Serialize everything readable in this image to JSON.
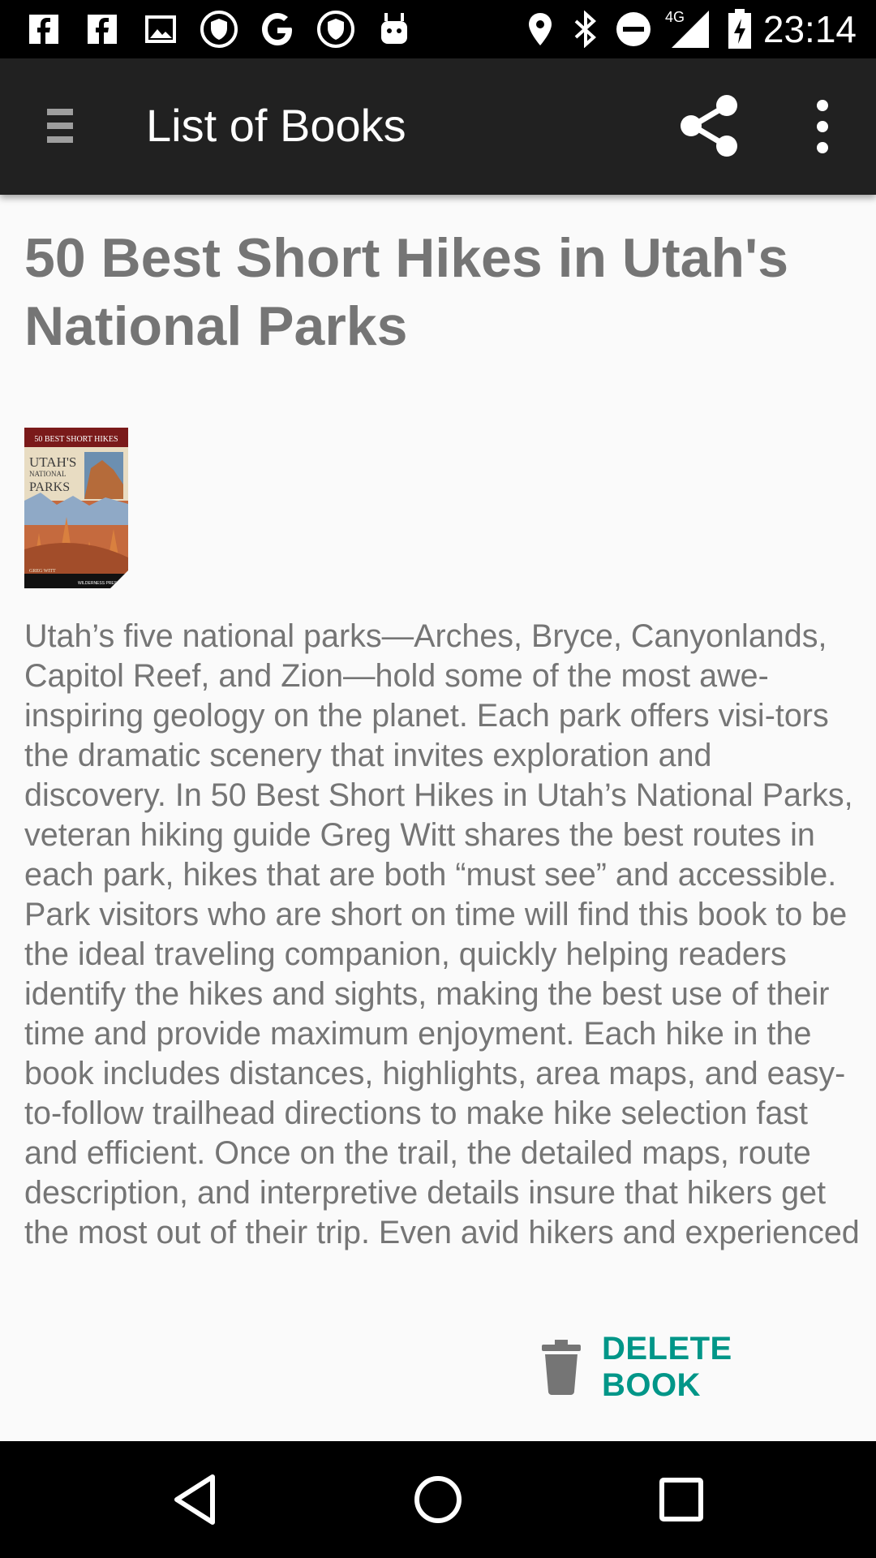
{
  "status_bar": {
    "time": "23:14",
    "network": "4G",
    "icons": [
      "facebook-icon",
      "facebook-icon",
      "image-icon",
      "shield-icon",
      "google-icon",
      "shield-icon",
      "android-icon",
      "location-icon",
      "bluetooth-icon",
      "dnd-icon",
      "signal-icon",
      "battery-charging-icon"
    ]
  },
  "app_bar": {
    "title": "List of Books",
    "menu_icon": "menu-icon",
    "share_icon": "share-icon",
    "more_icon": "more-vert-icon"
  },
  "book": {
    "title": "50 Best Short Hikes in Utah's National Parks",
    "cover": {
      "top_text": "50 BEST SHORT HIKES",
      "main_text_1": "UTAH'S",
      "main_text_2": "NATIONAL",
      "main_text_3": "PARKS",
      "author": "GREG WITT",
      "publisher": "WILDERNESS PRESS"
    },
    "description": "Utah’s five national parks—Arches, Bryce, Canyonlands, Capitol Reef, and Zion—hold some of the most awe-inspiring geology on the planet. Each park offers visi-tors the dramatic scenery that invites exploration and discovery. In 50 Best Short Hikes in Utah’s National Parks, veteran hiking guide Greg Witt shares the best routes in each park, hikes that are both “must see” and accessible. Park visitors who are short on time will find this book to be the ideal traveling companion, quickly helping readers identify the hikes and sights, making the best use of their time and provide maximum enjoyment. Each hike in the book includes distances, highlights, area maps, and easy-to-follow trailhead directions to make hike selection fast and efficient. Once on the trail, the detailed maps, route description, and interpretive details insure that hikers get the most out of their trip. Even avid hikers and experienced"
  },
  "actions": {
    "delete_label": "DELETE BOOK",
    "delete_icon": "trash-icon"
  },
  "nav_bar": {
    "back_icon": "back-icon",
    "home_icon": "home-icon",
    "recents_icon": "recents-icon"
  },
  "colors": {
    "status_bar": "#000000",
    "app_bar": "#212121",
    "background": "#fafafa",
    "text_gray": "#757575",
    "accent": "#009688"
  }
}
